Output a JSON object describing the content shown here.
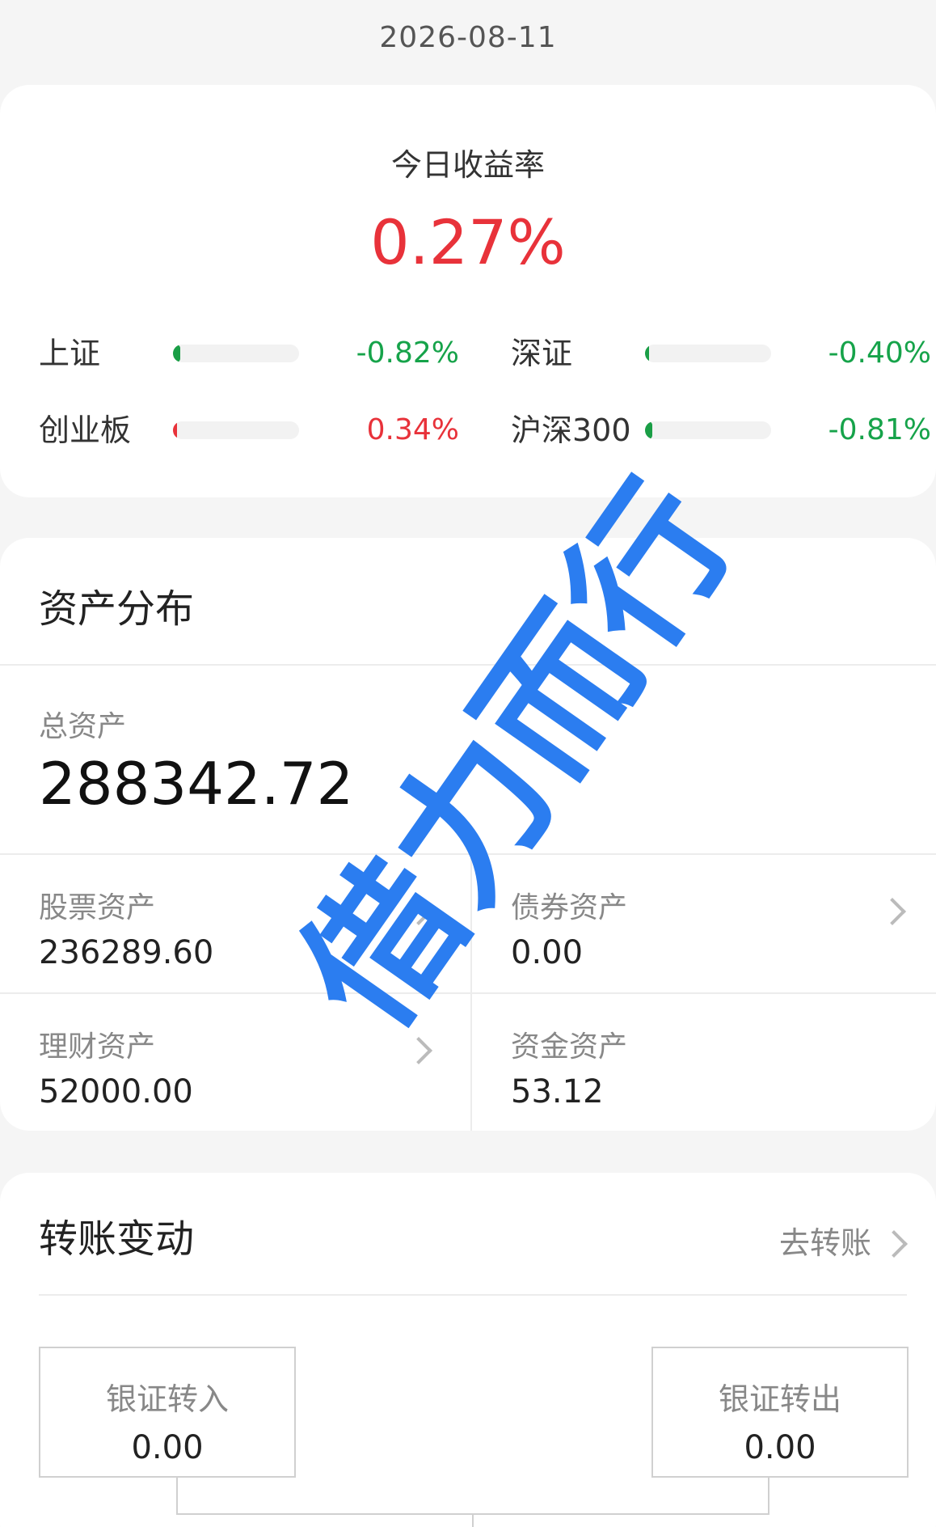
{
  "date": "2026-08-11",
  "today_return": {
    "label": "今日收益率",
    "value": "0.27%"
  },
  "indices": [
    {
      "name": "上证",
      "pct": "-0.82%",
      "level": 0.06,
      "color": "#16a34a"
    },
    {
      "name": "深证",
      "pct": "-0.40%",
      "level": 0.03,
      "color": "#16a34a"
    },
    {
      "name": "创业板",
      "pct": "0.34%",
      "level": 0.03,
      "color": "#e8323a"
    },
    {
      "name": "沪深300",
      "pct": "-0.81%",
      "level": 0.06,
      "color": "#16a34a"
    }
  ],
  "assets": {
    "title": "资产分布",
    "total_label": "总资产",
    "total_value": "288342.72",
    "cells": [
      {
        "label": "股票资产",
        "value": "236289.60"
      },
      {
        "label": "债券资产",
        "value": "0.00"
      },
      {
        "label": "理财资产",
        "value": "52000.00"
      },
      {
        "label": "资金资产",
        "value": "53.12"
      }
    ]
  },
  "transfer": {
    "title": "转账变动",
    "link": "去转账",
    "in_label": "银证转入",
    "in_value": "0.00",
    "out_label": "银证转出",
    "out_value": "0.00"
  },
  "watermark": "借力而行",
  "colors": {
    "up": "#e8323a",
    "down": "#16a34a",
    "watermark": "#2b7df0"
  }
}
